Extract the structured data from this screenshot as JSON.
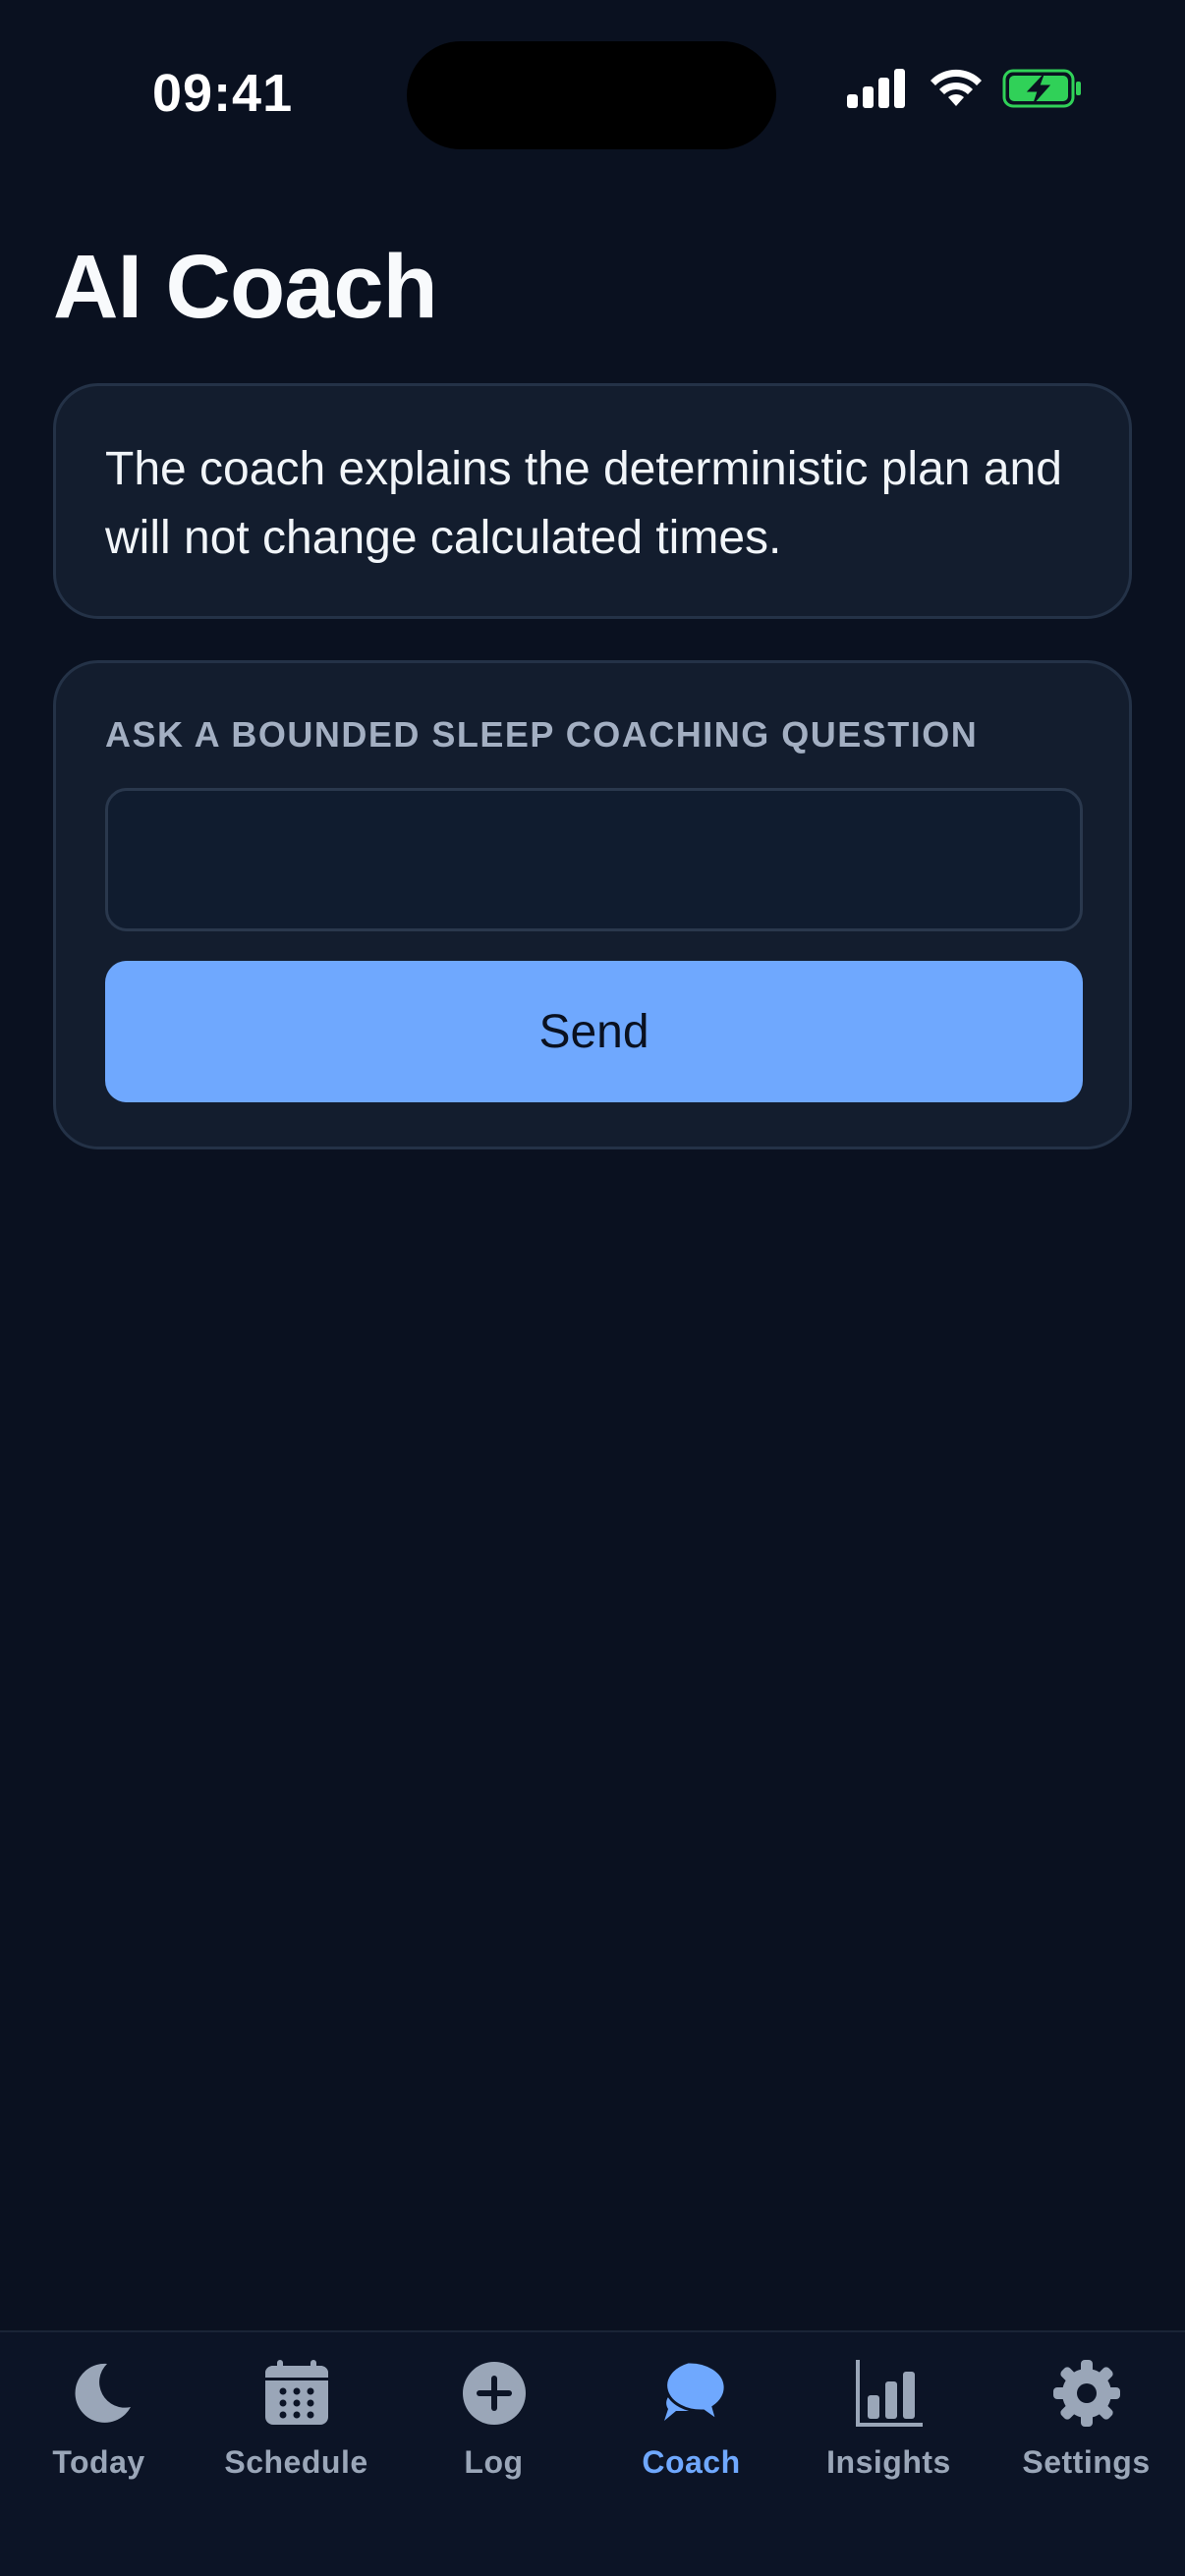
{
  "status_bar": {
    "time": "09:41",
    "icons": [
      "signal-icon",
      "wifi-icon",
      "battery-charging-icon"
    ],
    "battery_color": "#30d158"
  },
  "page": {
    "title": "AI Coach"
  },
  "info_card": {
    "text": "The coach explains the deterministic plan and will not change calculated times."
  },
  "ask_card": {
    "label": "ASK A BOUNDED SLEEP COACHING QUESTION",
    "input_value": "",
    "input_placeholder": "",
    "send_label": "Send"
  },
  "tab_bar": {
    "active_tab": "Coach",
    "tabs": [
      {
        "label": "Today",
        "icon": "moon-icon"
      },
      {
        "label": "Schedule",
        "icon": "calendar-icon"
      },
      {
        "label": "Log",
        "icon": "plus-circle-icon"
      },
      {
        "label": "Coach",
        "icon": "chat-bubbles-icon"
      },
      {
        "label": "Insights",
        "icon": "bar-chart-icon"
      },
      {
        "label": "Settings",
        "icon": "gear-icon"
      }
    ]
  },
  "colors": {
    "background": "#0a1120",
    "card": "#131d2e",
    "accent": "#6fa8fe",
    "inactive_tab": "#9aa6b8"
  }
}
